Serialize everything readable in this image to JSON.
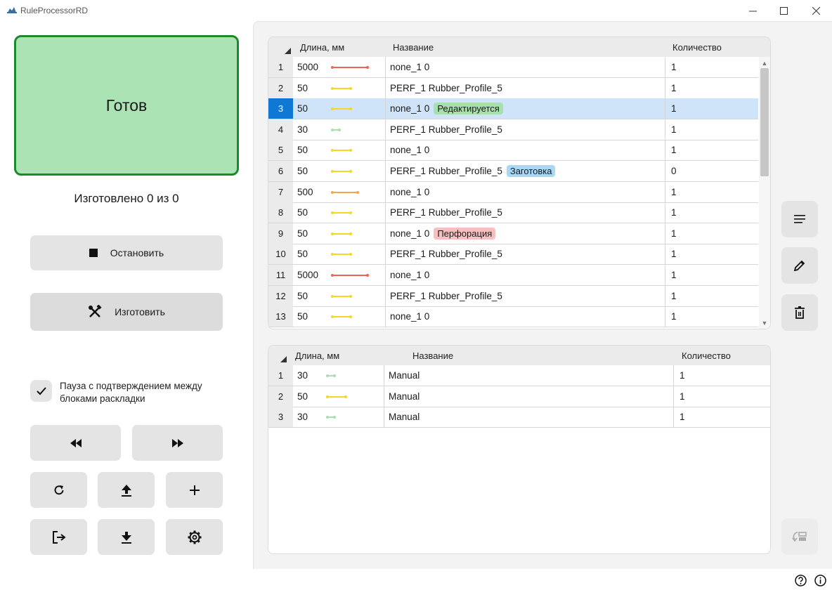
{
  "window": {
    "title": "RuleProcessorRD",
    "controls": [
      "minimize-icon",
      "maximize-icon",
      "close-icon"
    ]
  },
  "status": {
    "label": "Готов",
    "color": "#abe3b5",
    "border": "#1b8a2b"
  },
  "made_count": "Изготовлено 0 из 0",
  "buttons": {
    "stop": {
      "label": "Остановить",
      "icon": "stop-icon"
    },
    "make": {
      "label": "Изготовить",
      "icon": "tools-icon"
    },
    "rewind": {
      "icon": "rewind-icon"
    },
    "forward": {
      "icon": "fast-forward-icon"
    },
    "refresh": {
      "icon": "refresh-icon"
    },
    "upload": {
      "icon": "upload-icon"
    },
    "add": {
      "icon": "plus-icon"
    },
    "exit": {
      "icon": "logout-icon"
    },
    "download": {
      "icon": "download-icon"
    },
    "settings": {
      "icon": "gear-icon"
    }
  },
  "pause_checkbox": {
    "checked": true,
    "label": "Пауза с подтверждением между блоками раскладки"
  },
  "top_table": {
    "headers": {
      "length": "Длина, мм",
      "name": "Название",
      "qty": "Количество"
    },
    "rows": [
      {
        "idx": "1",
        "length": "5000",
        "name": "none_1 0",
        "badge": "",
        "qty": "1",
        "color": "#e8665a"
      },
      {
        "idx": "2",
        "length": "50",
        "name": "PERF_1 Rubber_Profile_5",
        "badge": "",
        "qty": "1",
        "color": "#f4d924"
      },
      {
        "idx": "3",
        "length": "50",
        "name": "none_1 0",
        "badge": "Редактируется",
        "badge_bg": "#a6e0ad",
        "qty": "1",
        "color": "#f4d924",
        "selected": true
      },
      {
        "idx": "4",
        "length": "30",
        "name": "PERF_1 Rubber_Profile_5",
        "badge": "",
        "qty": "1",
        "color": "#a8dfae"
      },
      {
        "idx": "5",
        "length": "50",
        "name": "none_1 0",
        "badge": "",
        "qty": "1",
        "color": "#f4d924"
      },
      {
        "idx": "6",
        "length": "50",
        "name": "PERF_1 Rubber_Profile_5",
        "badge": "Заготовка",
        "badge_bg": "#a9d8f5",
        "qty": "0",
        "color": "#f4d924"
      },
      {
        "idx": "7",
        "length": "500",
        "name": "none_1 0",
        "badge": "",
        "qty": "1",
        "color": "#f0a64a"
      },
      {
        "idx": "8",
        "length": "50",
        "name": "PERF_1 Rubber_Profile_5",
        "badge": "",
        "qty": "1",
        "color": "#f4d924"
      },
      {
        "idx": "9",
        "length": "50",
        "name": "none_1 0",
        "badge": "Перфорация",
        "badge_bg": "#f7c0c0",
        "qty": "1",
        "color": "#f4d924"
      },
      {
        "idx": "10",
        "length": "50",
        "name": "PERF_1 Rubber_Profile_5",
        "badge": "",
        "qty": "1",
        "color": "#f4d924"
      },
      {
        "idx": "11",
        "length": "5000",
        "name": "none_1 0",
        "badge": "",
        "qty": "1",
        "color": "#e8665a"
      },
      {
        "idx": "12",
        "length": "50",
        "name": "PERF_1 Rubber_Profile_5",
        "badge": "",
        "qty": "1",
        "color": "#f4d924"
      },
      {
        "idx": "13",
        "length": "50",
        "name": "none_1 0",
        "badge": "",
        "qty": "1",
        "color": "#f4d924"
      }
    ]
  },
  "bottom_table": {
    "headers": {
      "length": "Длина, мм",
      "name": "Название",
      "qty": "Количество"
    },
    "rows": [
      {
        "idx": "1",
        "length": "30",
        "name": "Manual",
        "qty": "1",
        "color": "#a8dfae"
      },
      {
        "idx": "2",
        "length": "50",
        "name": "Manual",
        "qty": "1",
        "color": "#f4d924"
      },
      {
        "idx": "3",
        "length": "30",
        "name": "Manual",
        "qty": "1",
        "color": "#a8dfae"
      }
    ]
  },
  "side_buttons": [
    "list-icon",
    "pencil-icon",
    "trash-icon",
    "transfer-icon"
  ],
  "footer_icons": [
    "help-icon",
    "info-icon"
  ]
}
